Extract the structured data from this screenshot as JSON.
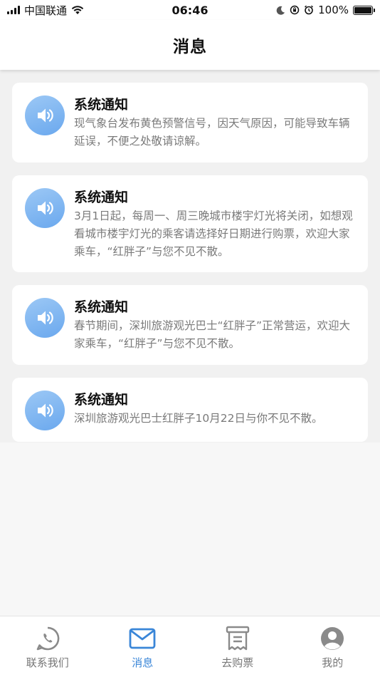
{
  "status_bar": {
    "carrier": "中国联通",
    "time": "06:46",
    "battery": "100%"
  },
  "header": {
    "title": "消息"
  },
  "messages": [
    {
      "title": "系统通知",
      "text": "现气象台发布黄色预警信号，因天气原因，可能导致车辆延误，不便之处敬请谅解。",
      "icon": "speaker-icon"
    },
    {
      "title": "系统通知",
      "text": "3月1日起，每周一、周三晚城市楼宇灯光将关闭，如想观看城市楼宇灯光的乘客请选择好日期进行购票，欢迎大家乘车，“红胖子”与您不见不散。",
      "icon": "speaker-icon"
    },
    {
      "title": "系统通知",
      "text": "春节期间，深圳旅游观光巴士“红胖子”正常营运，欢迎大家乘车，“红胖子”与您不见不散。",
      "icon": "speaker-icon"
    },
    {
      "title": "系统通知",
      "text": "深圳旅游观光巴士红胖子10月22日与你不见不散。",
      "icon": "speaker-icon"
    }
  ],
  "tabbar": {
    "tabs": [
      {
        "label": "联系我们",
        "icon": "phone-chat-icon",
        "active": false
      },
      {
        "label": "消息",
        "icon": "mail-icon",
        "active": true
      },
      {
        "label": "去购票",
        "icon": "receipt-icon",
        "active": false
      },
      {
        "label": "我的",
        "icon": "user-icon",
        "active": false
      }
    ]
  },
  "colors": {
    "accent": "#3a86d8",
    "icon_gradient_start": "#9cc8f5",
    "icon_gradient_end": "#6aa8ee",
    "inactive": "#777777"
  }
}
